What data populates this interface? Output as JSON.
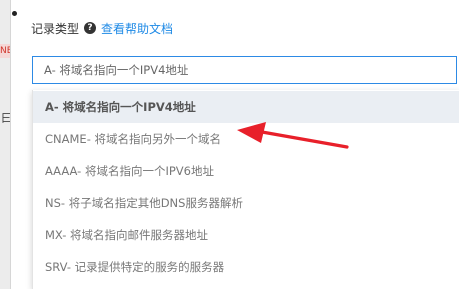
{
  "form": {
    "label": "记录类型",
    "help_icon": "question-icon",
    "help_link": "查看帮助文档"
  },
  "select": {
    "value": "A- 将域名指向一个IPV4地址"
  },
  "dropdown": {
    "options": [
      {
        "label": "A- 将域名指向一个IPV4地址",
        "selected": true
      },
      {
        "label": "CNAME- 将域名指向另外一个域名",
        "selected": false
      },
      {
        "label": "AAAA- 将域名指向一个IPV6地址",
        "selected": false
      },
      {
        "label": "NS- 将子域名指定其他DNS服务器解析",
        "selected": false
      },
      {
        "label": "MX- 将域名指向邮件服务器地址",
        "selected": false
      },
      {
        "label": "SRV- 记录提供特定的服务的服务器",
        "selected": false
      }
    ]
  },
  "background": {
    "badge_text": "NE",
    "side_char": "曰"
  },
  "colors": {
    "accent": "#1f8ae6",
    "selected_bg": "#eaeef3",
    "annotation": "#e8202a"
  }
}
